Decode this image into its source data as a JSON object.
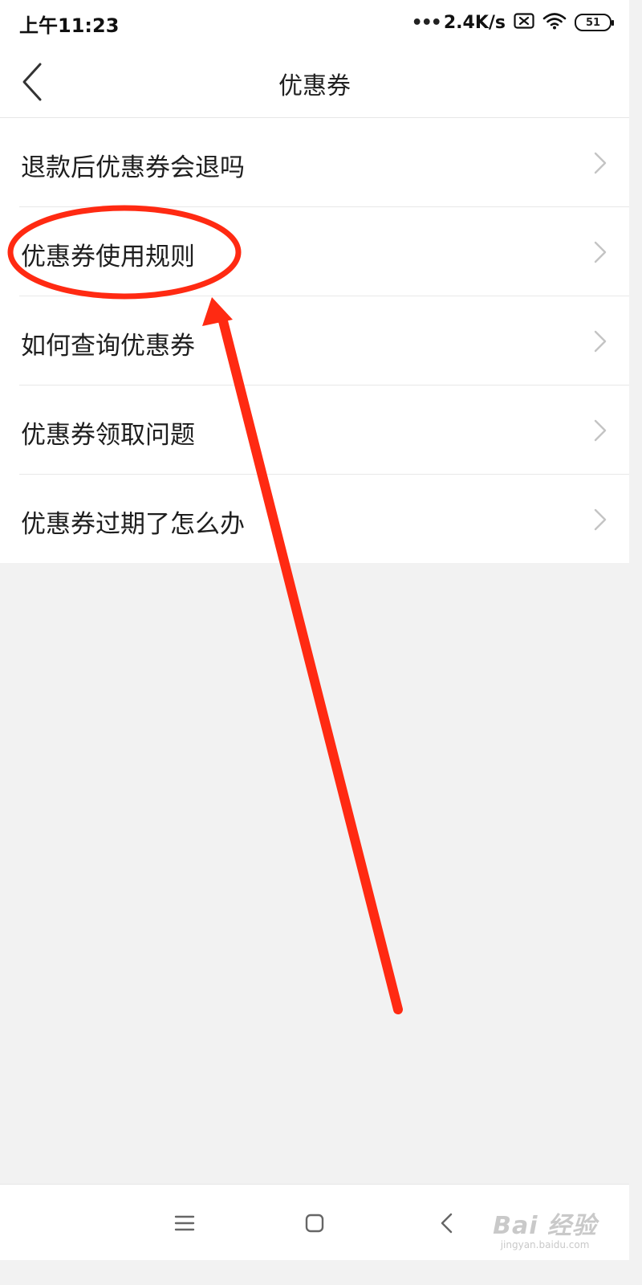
{
  "status_bar": {
    "time": "上午11:23",
    "dots": "•••",
    "network_speed": "2.4K/s",
    "battery": "51",
    "icons": [
      "sim-off-icon",
      "wifi-icon",
      "battery-icon"
    ]
  },
  "header": {
    "title": "优惠券",
    "back_icon": "chevron-left-icon"
  },
  "faq": {
    "items": [
      {
        "label": "退款后优惠券会退吗"
      },
      {
        "label": "优惠券使用规则"
      },
      {
        "label": "如何查询优惠券"
      },
      {
        "label": "优惠券领取问题"
      },
      {
        "label": "优惠券过期了怎么办"
      }
    ],
    "chevron_icon": "chevron-right-icon"
  },
  "annotation": {
    "color": "#ff2a12",
    "highlighted_item_index": 1
  },
  "nav_bar": {
    "icons": [
      "menu-icon",
      "home-icon",
      "back-icon"
    ]
  },
  "watermark": {
    "logo": "Bai 经验",
    "url": "jingyan.baidu.com"
  },
  "colors": {
    "background": "#f2f2f2",
    "surface": "#ffffff",
    "divider": "#e8e8e8",
    "text": "#1e1e1e",
    "chevron": "#c4c4c4"
  }
}
